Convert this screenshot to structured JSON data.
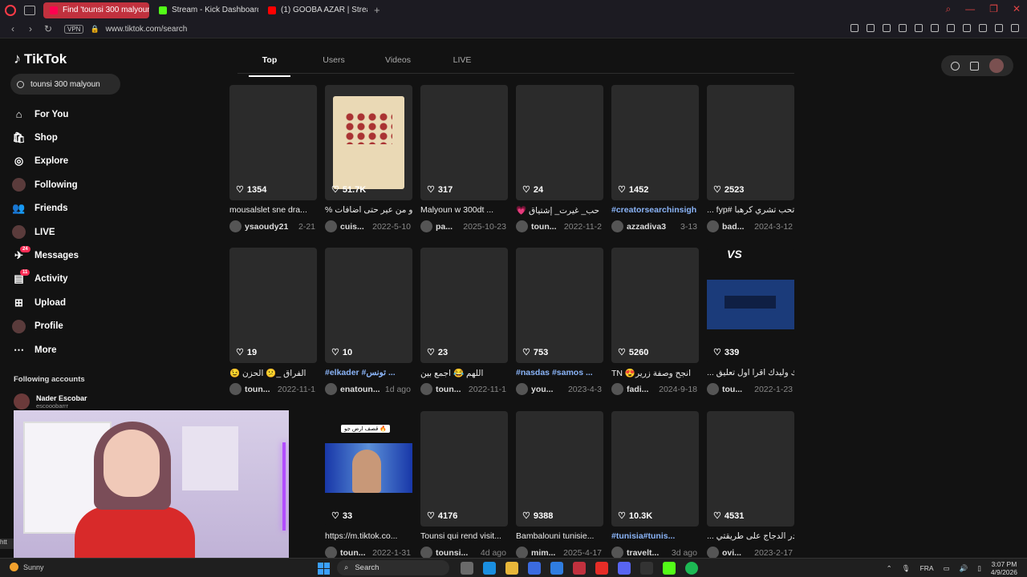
{
  "browser": {
    "tabs": [
      {
        "label": "Find 'tounsi 300 malyoun'",
        "active": true,
        "color": "#ff0050"
      },
      {
        "label": "Stream - Kick Dashboard",
        "active": false,
        "color": "#53fc18"
      },
      {
        "label": "(1) GOOBA AZAR | Stream",
        "active": false,
        "color": "#ff0000"
      }
    ],
    "vpn_label": "VPN",
    "url": "www.tiktok.com/search",
    "new_tab": "+"
  },
  "tiktok": {
    "logo": "TikTok",
    "search_value": "tounsi 300 malyoun",
    "nav": [
      {
        "label": "For You",
        "icon": "home-icon",
        "glyph": "⌂"
      },
      {
        "label": "Shop",
        "icon": "shop-icon",
        "glyph": "🛍"
      },
      {
        "label": "Explore",
        "icon": "compass-icon",
        "glyph": "◎"
      },
      {
        "label": "Following",
        "icon": "following-avatar-icon",
        "glyph": ""
      },
      {
        "label": "Friends",
        "icon": "friends-icon",
        "glyph": "👥"
      },
      {
        "label": "LIVE",
        "icon": "live-icon",
        "glyph": ""
      },
      {
        "label": "Messages",
        "icon": "messages-icon",
        "glyph": "✈",
        "badge": "24"
      },
      {
        "label": "Activity",
        "icon": "activity-icon",
        "glyph": "▤",
        "badge": "11"
      },
      {
        "label": "Upload",
        "icon": "upload-icon",
        "glyph": "⊞"
      },
      {
        "label": "Profile",
        "icon": "profile-icon",
        "glyph": ""
      },
      {
        "label": "More",
        "icon": "more-icon",
        "glyph": "⋯"
      }
    ],
    "following_heading": "Following accounts",
    "following_account": {
      "name": "Nader Escobar",
      "handle": "escooobarrr"
    },
    "search_tabs": [
      "Top",
      "Users",
      "Videos",
      "LIVE"
    ],
    "active_tab": "Top",
    "videos": [
      {
        "likes": "1354",
        "title": "mousalslet sne dra...",
        "user": "ysaoudy21",
        "date": "2-21",
        "tag": false
      },
      {
        "likes": "51.7K",
        "title": "% و من عير حتى اضافات...",
        "user": "cuis...",
        "date": "2022-5-10",
        "tag": false,
        "thumb": "bread"
      },
      {
        "likes": "317",
        "title": "Malyoun w 300dt ...",
        "user": "pa...",
        "date": "2025-10-23",
        "tag": false
      },
      {
        "likes": "24",
        "title": "💗 حب_ غيرت_ إشتياق",
        "user": "toun...",
        "date": "2022-11-2",
        "tag": false
      },
      {
        "likes": "1452",
        "title": "#creatorsearchinsigh",
        "user": "azzadiva3",
        "date": "3-13",
        "tag": true
      },
      {
        "likes": "2523",
        "title": "... fyp# تحب تشري كرهبا",
        "user": "bad...",
        "date": "2024-3-12",
        "tag": false
      },
      {
        "likes": "19",
        "title": "😉 الفراق _😕 الحزن",
        "user": "toun...",
        "date": "2022-11-1",
        "tag": false
      },
      {
        "likes": "10",
        "title": "#elkader #تونس ...",
        "user": "enatoun...",
        "date": "1d ago",
        "tag": true
      },
      {
        "likes": "23",
        "title": "اللهم 😂 اجمع بين",
        "user": "toun...",
        "date": "2022-11-1",
        "tag": false
      },
      {
        "likes": "753",
        "title": "#nasdas #samos ...",
        "user": "you...",
        "date": "2023-4-3",
        "tag": true
      },
      {
        "likes": "5260",
        "title": "TN 😍انجح وصفة زرير",
        "user": "fadi...",
        "date": "2024-9-18",
        "tag": false
      },
      {
        "likes": "339",
        "title": "... يخليك وليدك اقرا اول تعليق",
        "user": "tou...",
        "date": "2022-1-23",
        "tag": false,
        "thumb": "vs",
        "vs": "VS"
      },
      {
        "likes": "",
        "title": "",
        "user": "",
        "date": "",
        "tag": false
      },
      {
        "likes": "33",
        "title": "https://m.tiktok.co...",
        "user": "toun...",
        "date": "2022-1-31",
        "tag": false,
        "thumb": "tv",
        "caption": "قصف ارض جو 🔥"
      },
      {
        "likes": "4176",
        "title": "Tounsi qui rend visit...",
        "user": "tounsi...",
        "date": "4d ago",
        "tag": false
      },
      {
        "likes": "9388",
        "title": "Bambalouni tunisie...",
        "user": "mim...",
        "date": "2025-4-17",
        "tag": false
      },
      {
        "likes": "10.3K",
        "title": "#tunisia#tunis...",
        "user": "travelt...",
        "date": "3d ago",
        "tag": true
      },
      {
        "likes": "4531",
        "title": "... وصدر الدجاج على طريقتي",
        "user": "ovi...",
        "date": "2023-2-17",
        "tag": false
      }
    ]
  },
  "webcam": {
    "label": "streamer webcam"
  },
  "status_text": "htt",
  "taskbar": {
    "weather": "Sunny",
    "search_label": "Search",
    "language": "FRA",
    "time": "3:07 PM",
    "date": "4/9/2026"
  }
}
